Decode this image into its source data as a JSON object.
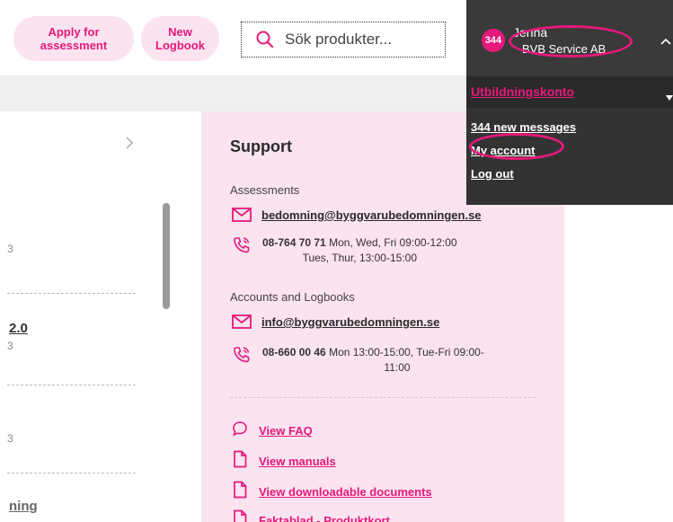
{
  "header": {
    "apply_label_1": "Apply for",
    "apply_label_2": "assessment",
    "new_logbook_1": "New",
    "new_logbook_2": "Logbook",
    "search_placeholder": "Sök produkter..."
  },
  "left_column": {
    "items": [
      {
        "frag": "3"
      },
      {
        "title": "2.0",
        "frag": "3"
      },
      {
        "frag": "3"
      },
      {
        "title": "ning"
      }
    ]
  },
  "support": {
    "title": "Support",
    "assessments_label": "Assessments",
    "assessments_email": "bedomning@byggvarubedomningen.se",
    "assessments_phone": "08-764 70 71",
    "assessments_hours_1": " Mon, Wed, Fri 09:00-12:00",
    "assessments_hours_2": "Tues, Thur, 13:00-15:00",
    "accounts_label": "Accounts and Logbooks",
    "accounts_email": "info@byggvarubedomningen.se",
    "accounts_phone": "08-660 00 46",
    "accounts_hours_1": " Mon 13:00-15:00, Tue-Fri 09:00-",
    "accounts_hours_2": "11:00",
    "links": [
      {
        "label": "View FAQ",
        "icon": "chat-bubble-icon"
      },
      {
        "label": "View manuals",
        "icon": "document-icon"
      },
      {
        "label": "View downloadable documents",
        "icon": "document-icon"
      },
      {
        "label": "Faktablad - Produktkort",
        "icon": "document-icon"
      }
    ]
  },
  "account_menu": {
    "badge_count": "344",
    "user_name": "Jenna",
    "company": "BVB Service AB",
    "account_name": "Utbildningskonto",
    "messages": "344 new messages",
    "my_account": "My account",
    "logout": "Log out"
  },
  "colors": {
    "accent": "#e5197b",
    "pill_bg": "#fbe3ef",
    "dropdown_bg": "#333333"
  }
}
